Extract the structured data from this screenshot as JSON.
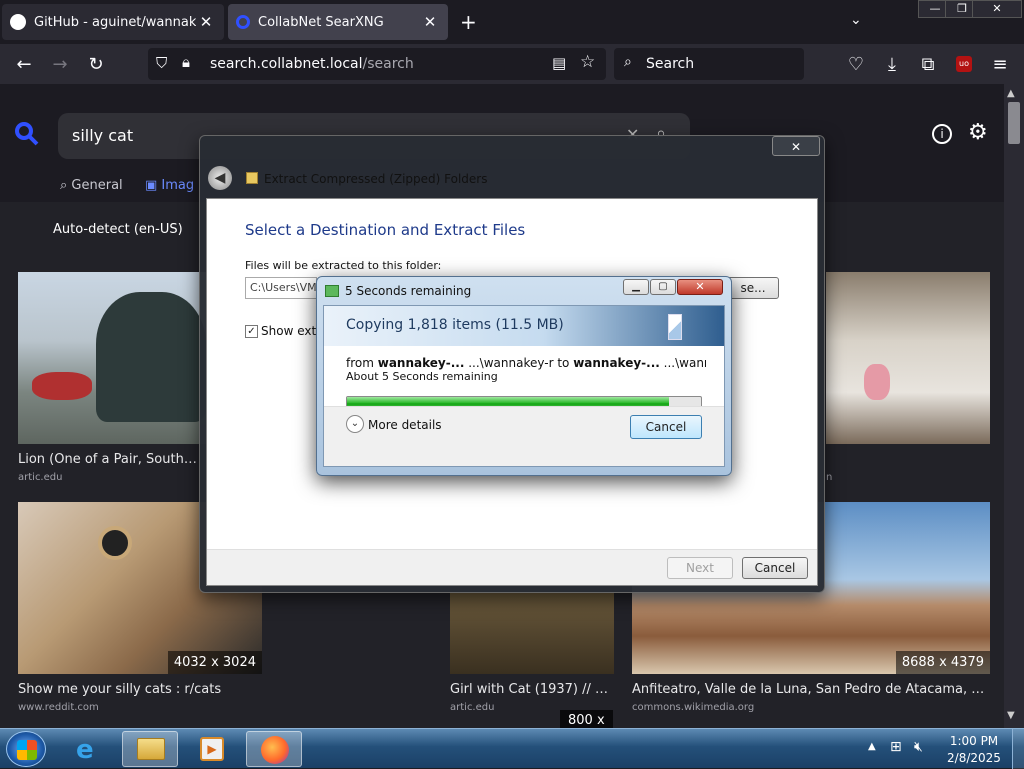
{
  "browser": {
    "tabs": [
      {
        "title": "GitHub - aguinet/wannakey: W"
      },
      {
        "title": "CollabNet SearXNG"
      }
    ],
    "url_host": "search.collabnet.local",
    "url_path": "/search",
    "search_placeholder": "Search",
    "ublock_label": "uo"
  },
  "page": {
    "query": "silly cat",
    "categories": {
      "general": "General",
      "images": "Imag"
    },
    "language": "Auto-detect (en-US)",
    "results": [
      {
        "title": "Lion (One of a Pair, South Pede",
        "source": "artic.edu"
      },
      {
        "title": "",
        "source": "n"
      },
      {
        "title": "Show me your silly cats : r/cats",
        "source": "www.reddit.com",
        "dims": "4032 x 3024"
      },
      {
        "title": "Girl with Cat (1937) // Bal...",
        "source": "artic.edu",
        "dims": "800 x"
      },
      {
        "title": "Anfiteatro, Valle de la Luna, San Pedro de Atacama, Chile, ...",
        "source": "commons.wikimedia.org",
        "dims": "8688 x 4379"
      }
    ]
  },
  "extract_dialog": {
    "title": "Extract Compressed (Zipped) Folders",
    "heading": "Select a Destination and Extract Files",
    "folder_label": "Files will be extracted to this folder:",
    "folder_value": "C:\\Users\\VM",
    "browse_label": "se...",
    "show_label": "Show extra",
    "next_label": "Next",
    "cancel_label": "Cancel"
  },
  "copy_dialog": {
    "title": "5 Seconds remaining",
    "heading": "Copying 1,818 items (11.5 MB)",
    "from_prefix": "from ",
    "from_name": "wannakey-...",
    "from_path": "  ...\\wannakey-r to ",
    "to_name": "wannakey-...",
    "to_path": "  ...\\wannakey-r",
    "remaining": "About 5 Seconds remaining",
    "progress_fraction": 0.91,
    "more_details": "More details",
    "cancel_label": "Cancel"
  },
  "taskbar": {
    "time": "1:00 PM",
    "date": "2/8/2025"
  }
}
